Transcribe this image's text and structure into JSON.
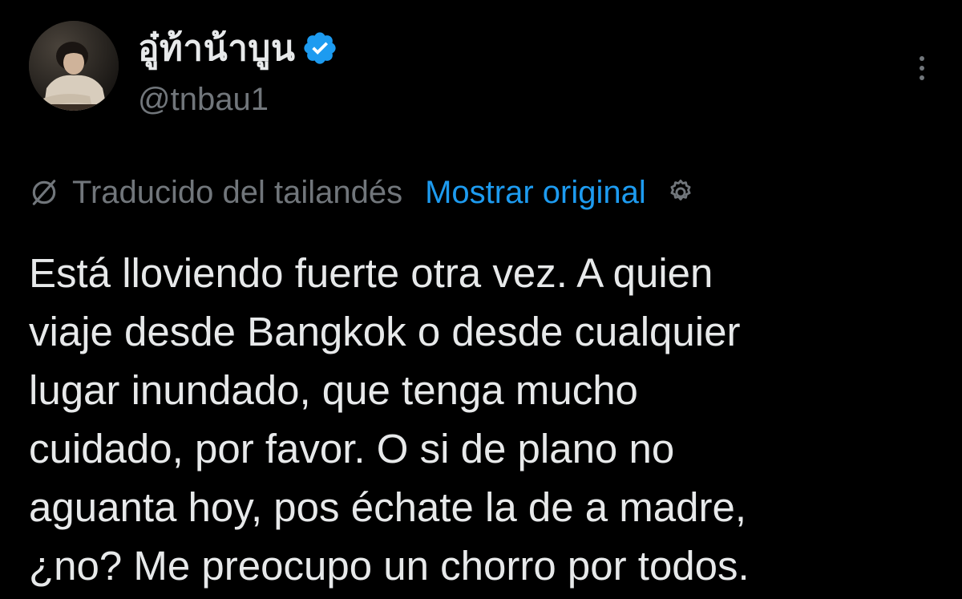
{
  "author": {
    "display_name": "อู๋ท้าน้าบูน",
    "handle": "@tnbau1",
    "verified": true,
    "avatar_icon": "profile-photo"
  },
  "translation": {
    "label": "Traducido del tailandés",
    "show_original": "Mostrar original",
    "icon": "globe-slash-icon",
    "settings_icon": "gear-icon"
  },
  "tweet": {
    "text": "Está lloviendo fuerte otra vez. A quien\nviaje desde Bangkok o desde cualquier\nlugar inundado, que tenga mucho\ncuidado, por favor. O si de plano no\naguanta hoy, pos échate la de a madre,\n¿no? Me preocupo un chorro por todos."
  },
  "colors": {
    "background": "#000000",
    "text": "#e7e9ea",
    "muted": "#71767b",
    "accent": "#1d9bf0"
  }
}
